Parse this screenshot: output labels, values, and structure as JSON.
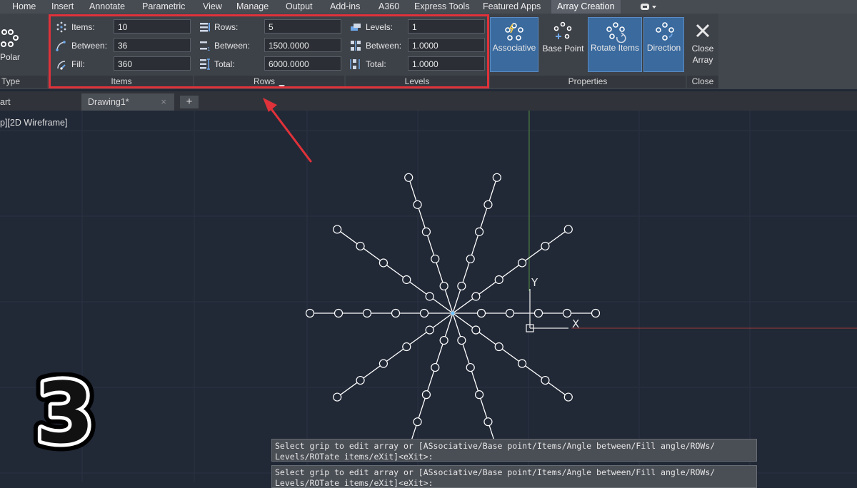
{
  "menu": {
    "items": [
      "Home",
      "Insert",
      "Annotate",
      "Parametric",
      "View",
      "Manage",
      "Output",
      "Add-ins",
      "A360",
      "Express Tools",
      "Featured Apps",
      "Array Creation"
    ],
    "active": "Array Creation"
  },
  "ribbon": {
    "type_panel": {
      "button_label": "Polar",
      "footer": "Type"
    },
    "items_panel": {
      "footer": "Items",
      "items_label": "Items:",
      "items_value": "10",
      "between_label": "Between:",
      "between_value": "36",
      "fill_label": "Fill:",
      "fill_value": "360"
    },
    "rows_panel": {
      "footer": "Rows",
      "rows_label": "Rows:",
      "rows_value": "5",
      "between_label": "Between:",
      "between_value": "1500.0000",
      "total_label": "Total:",
      "total_value": "6000.0000"
    },
    "levels_panel": {
      "footer": "Levels",
      "levels_label": "Levels:",
      "levels_value": "1",
      "between_label": "Between:",
      "between_value": "1.0000",
      "total_label": "Total:",
      "total_value": "1.0000"
    },
    "properties_panel": {
      "footer": "Properties",
      "associative": "Associative",
      "base_point": "Base Point",
      "rotate_items": "Rotate Items",
      "direction": "Direction"
    },
    "close_panel": {
      "footer": "Close",
      "close_line1": "Close",
      "close_line2": "Array"
    }
  },
  "tabs": {
    "start": "art",
    "drawing": "Drawing1*",
    "new_tab": "+",
    "close": "×"
  },
  "viewport_label": "p][2D Wireframe]",
  "axis": {
    "x": "X",
    "y": "Y"
  },
  "command_lines": [
    "Select grip to edit array or [ASsociative/Base point/Items/Angle between/Fill angle/ROWs/\nLevels/ROTate items/eXit]<eXit>:",
    "Select grip to edit array or [ASsociative/Base point/Items/Angle between/Fill angle/ROWs/\nLevels/ROTate items/eXit]<eXit>:"
  ],
  "overlay_number": "3",
  "colors": {
    "highlight": "#e0323a",
    "grip": "#ffffff",
    "background": "#212836",
    "button_active": "#3a6a9e"
  },
  "array": {
    "items": 10,
    "rows": 5,
    "fill_angle": 360
  }
}
